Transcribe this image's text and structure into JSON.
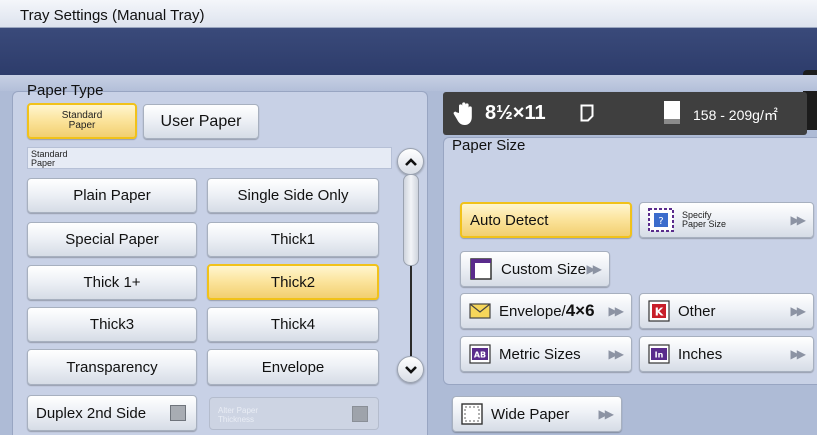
{
  "window": {
    "title": "Tray Settings (Manual Tray)"
  },
  "paper_type": {
    "section_label": "Paper Type",
    "tabs": [
      {
        "label_line1": "Standard",
        "label_line2": "Paper",
        "selected": true
      },
      {
        "label": "User Paper",
        "selected": false
      }
    ],
    "sub_header_line1": "Standard",
    "sub_header_line2": "Paper",
    "options": [
      {
        "label": "Plain Paper",
        "selected": false
      },
      {
        "label": "Single Side Only",
        "selected": false
      },
      {
        "label": "Special Paper",
        "selected": false
      },
      {
        "label": "Thick1",
        "selected": false
      },
      {
        "label": "Thick 1+",
        "selected": false
      },
      {
        "label": "Thick2",
        "selected": true
      },
      {
        "label": "Thick3",
        "selected": false
      },
      {
        "label": "Thick4",
        "selected": false
      },
      {
        "label": "Transparency",
        "selected": false
      },
      {
        "label": "Envelope",
        "selected": false
      }
    ],
    "duplex_label": "Duplex 2nd Side",
    "alter_thickness_line1": "Alter Paper",
    "alter_thickness_line2": "Thickness"
  },
  "status": {
    "size": "8½×11",
    "weight": "158 - 209g/㎡"
  },
  "paper_size": {
    "section_label": "Paper Size",
    "auto_detect": "Auto Detect",
    "specify_line1": "Specify",
    "specify_line2": "Paper Size",
    "custom_size": "Custom Size",
    "envelope_prefix": "Envelope/",
    "envelope_suffix": "4×6",
    "other": "Other",
    "metric": "Metric Sizes",
    "inches": "Inches",
    "wide_paper": "Wide Paper"
  },
  "colors": {
    "selected_fill": "#fbe39a",
    "selected_border": "#f1c21a",
    "nav_band": "#2d3c6b",
    "panel": "#c8d1e6"
  },
  "icons": [
    "hand-icon",
    "portrait-orientation-icon",
    "paper-stack-icon",
    "scroll-up-icon",
    "scroll-down-icon",
    "specify-size-icon",
    "custom-size-icon",
    "envelope-icon",
    "other-k-icon",
    "metric-ab-icon",
    "inches-in-icon",
    "wide-paper-icon",
    "double-chevron-icon"
  ]
}
